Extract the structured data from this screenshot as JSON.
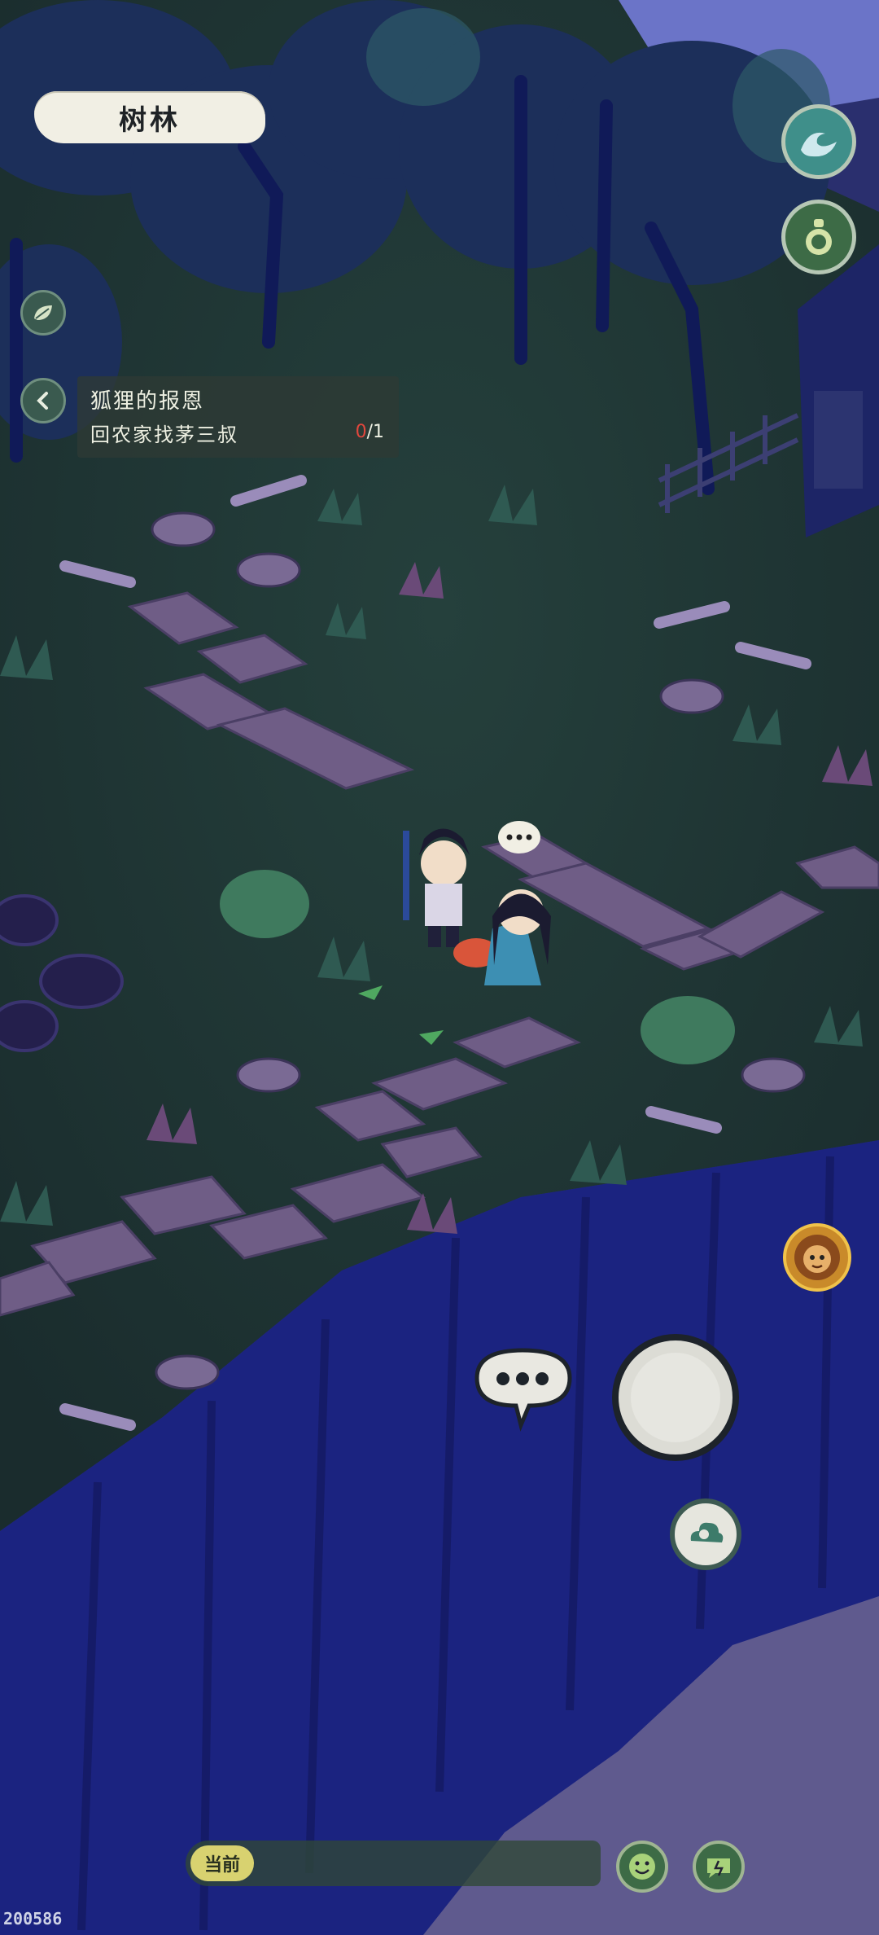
{
  "location": {
    "name": "树林"
  },
  "quest": {
    "title": "狐狸的报恩",
    "task": "回农家找茅三叔",
    "progress_current": "0",
    "progress_total": "/1"
  },
  "bottom_bar": {
    "current_label": "当前"
  },
  "version_text": "200586",
  "icons": {
    "leaf": "leaf-icon",
    "back": "chevron-left-icon",
    "wave": "wave-icon",
    "gourd": "gourd-icon",
    "npc_chat": "speech-bubble-icon",
    "chat": "chat-dots-icon",
    "joystick": "joystick-icon",
    "cloud": "cloud-swirl-icon",
    "character": "lion-avatar-icon",
    "emoji": "smile-icon",
    "quick_msg": "quick-message-icon"
  },
  "colors": {
    "sky": "#6b74c8",
    "ground": "#1f3534",
    "cliff": "#1b2380",
    "path_planks": "#6f5d86",
    "panel": "#2e3a34",
    "accent_red": "#e2473d"
  }
}
